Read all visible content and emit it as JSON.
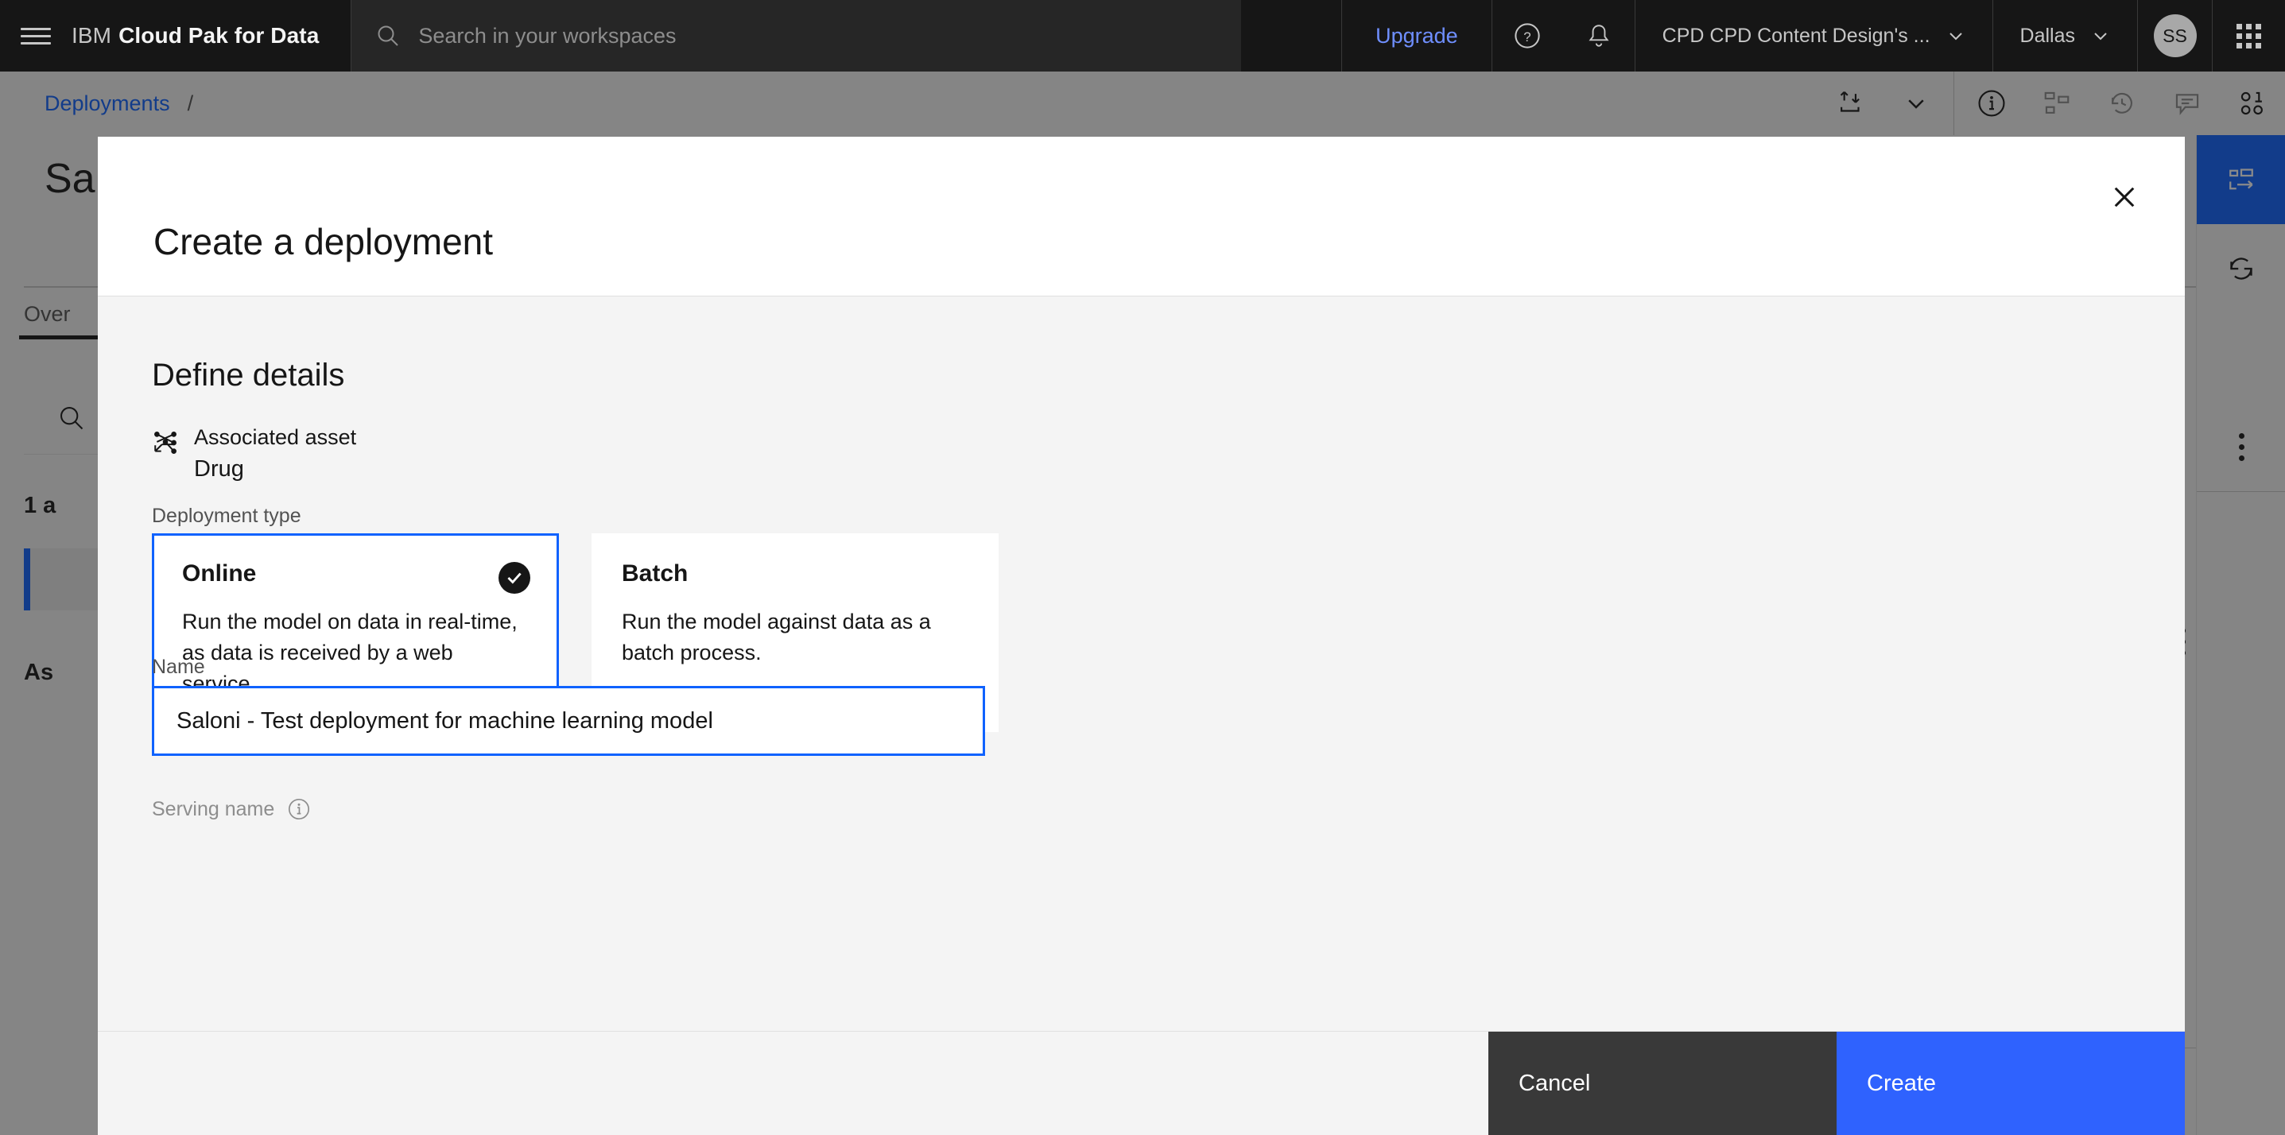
{
  "topbar": {
    "brand_light": "IBM",
    "brand_bold": "Cloud Pak for Data",
    "search_placeholder": "Search in your workspaces",
    "upgrade_label": "Upgrade",
    "help_icon": "help-circle-icon",
    "notification_icon": "bell-icon",
    "account_label": "CPD CPD Content Design's ...",
    "region_label": "Dallas",
    "avatar_initials": "SS",
    "app_switcher_icon": "app-grid-icon",
    "menu_icon": "hamburger-menu-icon"
  },
  "breadcrumb": {
    "link": "Deployments",
    "separator": "/",
    "actions": [
      {
        "name": "deploy-icon"
      },
      {
        "name": "chevron-down-icon"
      },
      {
        "name": "info-icon"
      },
      {
        "name": "hierarchy-icon"
      },
      {
        "name": "history-icon"
      },
      {
        "name": "comment-icon"
      },
      {
        "name": "binary-icon"
      }
    ]
  },
  "page": {
    "title": "Sa",
    "tab_label": "Over",
    "asset_count": "1 a",
    "assoc_heading": "As",
    "search_icon": "search-icon",
    "asset_row_icon": "copy-icon",
    "rail": {
      "active_icon": "sidepanel-icon",
      "refresh_icon": "refresh-icon",
      "overflow_icon": "overflow-menu-icon",
      "expand_icon": "play-triangle-icon"
    }
  },
  "modal": {
    "title": "Create a deployment",
    "close_icon": "close-icon",
    "section_title": "Define details",
    "associated_asset": {
      "icon": "model-asset-icon",
      "label": "Associated asset",
      "value": "Drug"
    },
    "deployment_type_label": "Deployment type",
    "deployment_types": [
      {
        "title": "Online",
        "description": "Run the model on data in real-time, as data is received by a web service.",
        "selected": true,
        "check_icon": "checkmark-filled-icon"
      },
      {
        "title": "Batch",
        "description": "Run the model against data as a batch process.",
        "selected": false
      }
    ],
    "name_label": "Name",
    "name_value": "Saloni - Test deployment for machine learning model",
    "serving_name_label": "Serving name",
    "serving_name_info_icon": "info-circle-icon",
    "cancel_label": "Cancel",
    "create_label": "Create"
  },
  "colors": {
    "brand_blue": "#0f62fe",
    "create_button": "#2f62fe",
    "cancel_button": "#393939",
    "header_black": "#161616",
    "body_gray": "#f4f4f4"
  }
}
